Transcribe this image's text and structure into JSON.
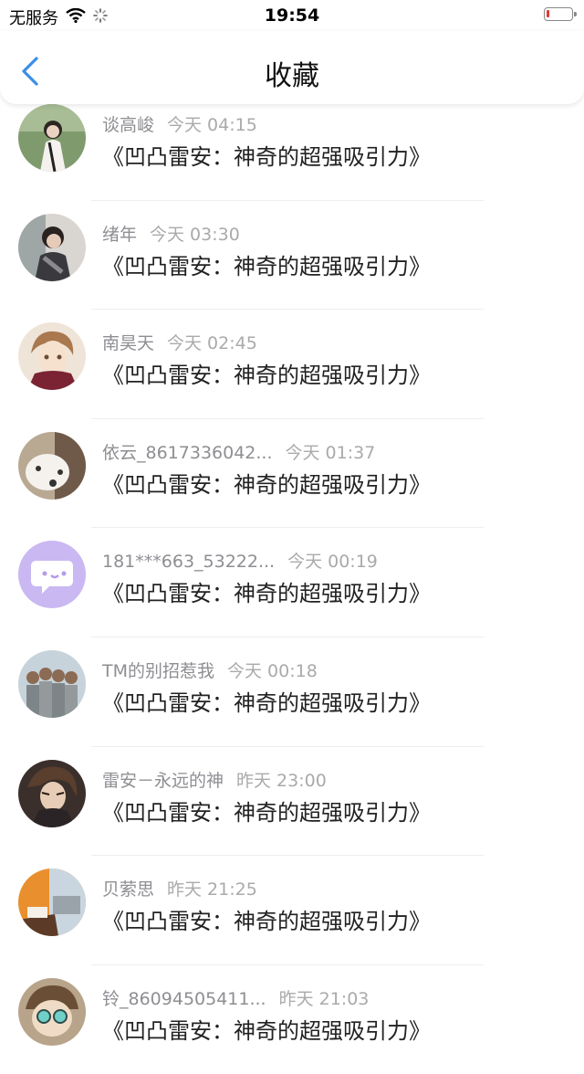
{
  "status_bar": {
    "carrier": "无服务",
    "time": "19:54"
  },
  "nav": {
    "title": "收藏"
  },
  "items": [
    {
      "user": "谈高峻",
      "time": "今天 04:15",
      "title": "《凹凸雷安：神奇的超强吸引力》"
    },
    {
      "user": "绪年",
      "time": "今天 03:30",
      "title": "《凹凸雷安：神奇的超强吸引力》"
    },
    {
      "user": "南昊天",
      "time": "今天 02:45",
      "title": "《凹凸雷安：神奇的超强吸引力》"
    },
    {
      "user": "依云_8617336042...",
      "time": "今天 01:37",
      "title": "《凹凸雷安：神奇的超强吸引力》"
    },
    {
      "user": "181***663_53222...",
      "time": "今天 00:19",
      "title": "《凹凸雷安：神奇的超强吸引力》"
    },
    {
      "user": "TM的别招惹我",
      "time": "今天 00:18",
      "title": "《凹凸雷安：神奇的超强吸引力》"
    },
    {
      "user": "雷安－永远的神",
      "time": "昨天 23:00",
      "title": "《凹凸雷安：神奇的超强吸引力》"
    },
    {
      "user": "贝萦思",
      "time": "昨天 21:25",
      "title": "《凹凸雷安：神奇的超强吸引力》"
    },
    {
      "user": "铃_86094505411...",
      "time": "昨天 21:03",
      "title": "《凹凸雷安：神奇的超强吸引力》"
    }
  ],
  "colors": {
    "accent": "#3b8ee8",
    "default_avatar": "#c9b8f2"
  }
}
